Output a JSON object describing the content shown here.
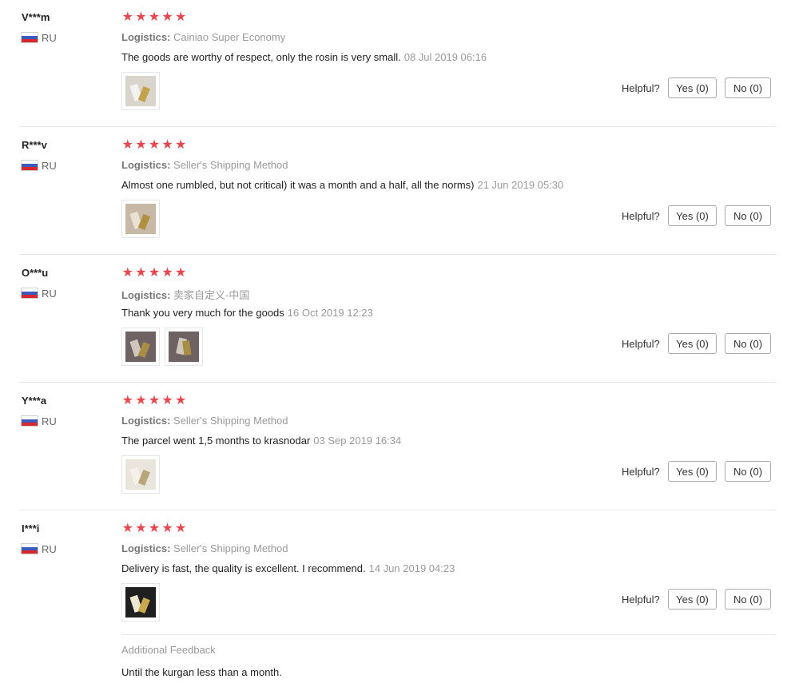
{
  "labels": {
    "logistics": "Logistics:",
    "helpful": "Helpful?",
    "yes": "Yes (0)",
    "no": "No (0)"
  },
  "reviews": [
    {
      "user": "V***m",
      "country": "RU",
      "rating": 5,
      "logistics": "Cainiao Super Economy",
      "content": "The goods are worthy of respect, only the rosin is very small.",
      "date": "08 Jul 2019 06:16",
      "photos": [
        "product-photo"
      ]
    },
    {
      "user": "R***v",
      "country": "RU",
      "rating": 5,
      "logistics": "Seller's Shipping Method",
      "content": "Almost one rumbled, but not critical) it was a month and a half, all the norms)",
      "date": "21 Jun 2019 05:30",
      "photos": [
        "product-photo"
      ]
    },
    {
      "user": "O***u",
      "country": "RU",
      "rating": 5,
      "logistics": "卖家自定义-中国",
      "content": "Thank you very much for the goods",
      "date": "16 Oct 2019 12:23",
      "photos": [
        "product-photo",
        "product-photo"
      ]
    },
    {
      "user": "Y***a",
      "country": "RU",
      "rating": 5,
      "logistics": "Seller's Shipping Method",
      "content": "The parcel went 1,5 months to krasnodar",
      "date": "03 Sep 2019 16:34",
      "photos": [
        "product-photo"
      ]
    },
    {
      "user": "I***i",
      "country": "RU",
      "rating": 5,
      "logistics": "Seller's Shipping Method",
      "content": "Delivery is fast, the quality is excellent. I recommend.",
      "date": "14 Jun 2019 04:23",
      "photos": [
        "product-photo"
      ]
    }
  ],
  "additional_feedback": {
    "label": "Additional Feedback",
    "text": "Until the kurgan less than a month."
  },
  "colors": {
    "star": "#e8474f",
    "muted": "#999999",
    "separator": "#e8e8e8"
  }
}
